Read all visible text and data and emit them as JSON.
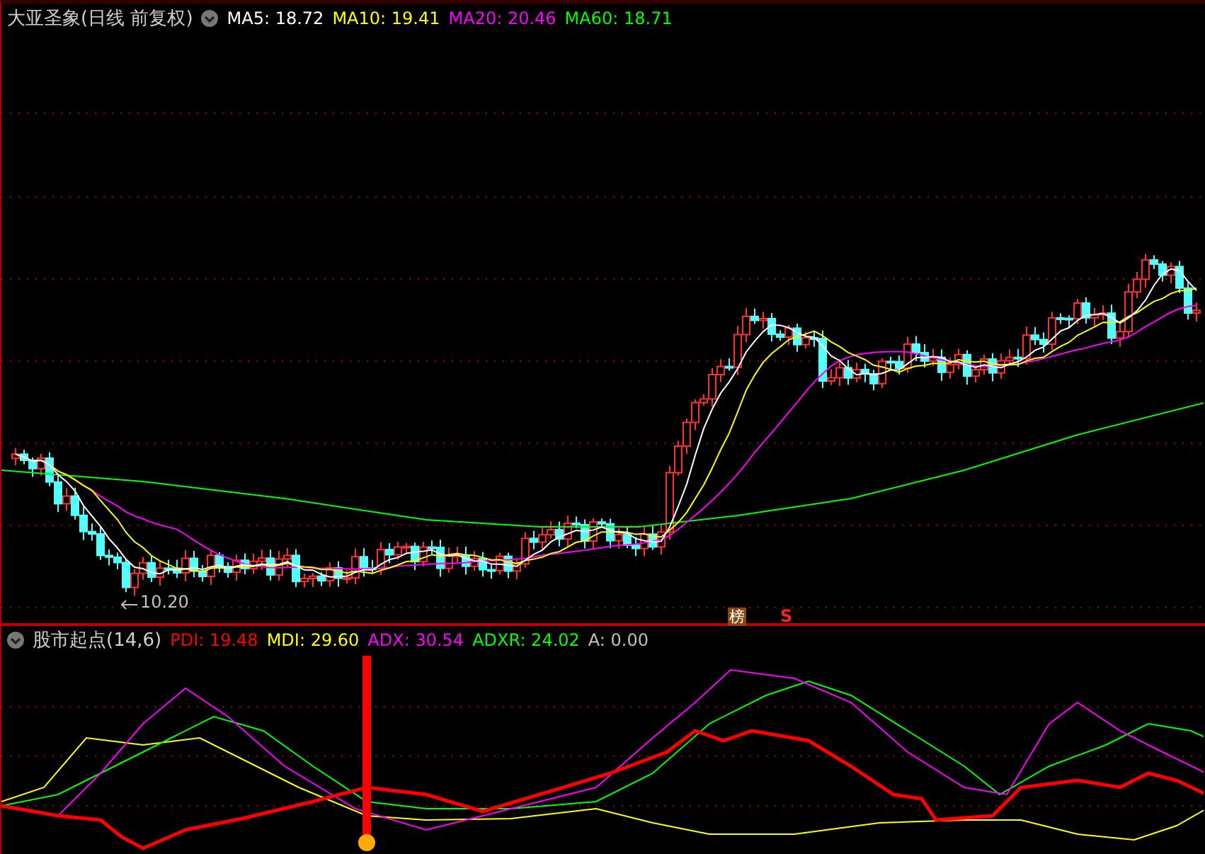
{
  "main_chart": {
    "title": "大亚圣象(日线 前复权)",
    "indicators": [
      {
        "label": "MA5: 18.72",
        "color": "#ffffff"
      },
      {
        "label": "MA10: 19.41",
        "color": "#ffff00"
      },
      {
        "label": "MA20: 20.46",
        "color": "#ff00ff"
      },
      {
        "label": "MA60: 18.71",
        "color": "#00ff00"
      }
    ],
    "low_label": "10.20",
    "markers": [
      {
        "kind": "badge",
        "text": "榜"
      },
      {
        "kind": "signal",
        "text": "S"
      }
    ]
  },
  "indicator_panel": {
    "title": "股市起点(14,6)",
    "indicators": [
      {
        "label": "PDI: 19.48",
        "color": "#ff0000"
      },
      {
        "label": "MDI: 29.60",
        "color": "#ffff00"
      },
      {
        "label": "ADX: 30.54",
        "color": "#ff00ff"
      },
      {
        "label": "ADXR: 24.02",
        "color": "#00ff00"
      },
      {
        "label": "A: 0.00",
        "color": "#c0c0c0"
      }
    ]
  }
}
